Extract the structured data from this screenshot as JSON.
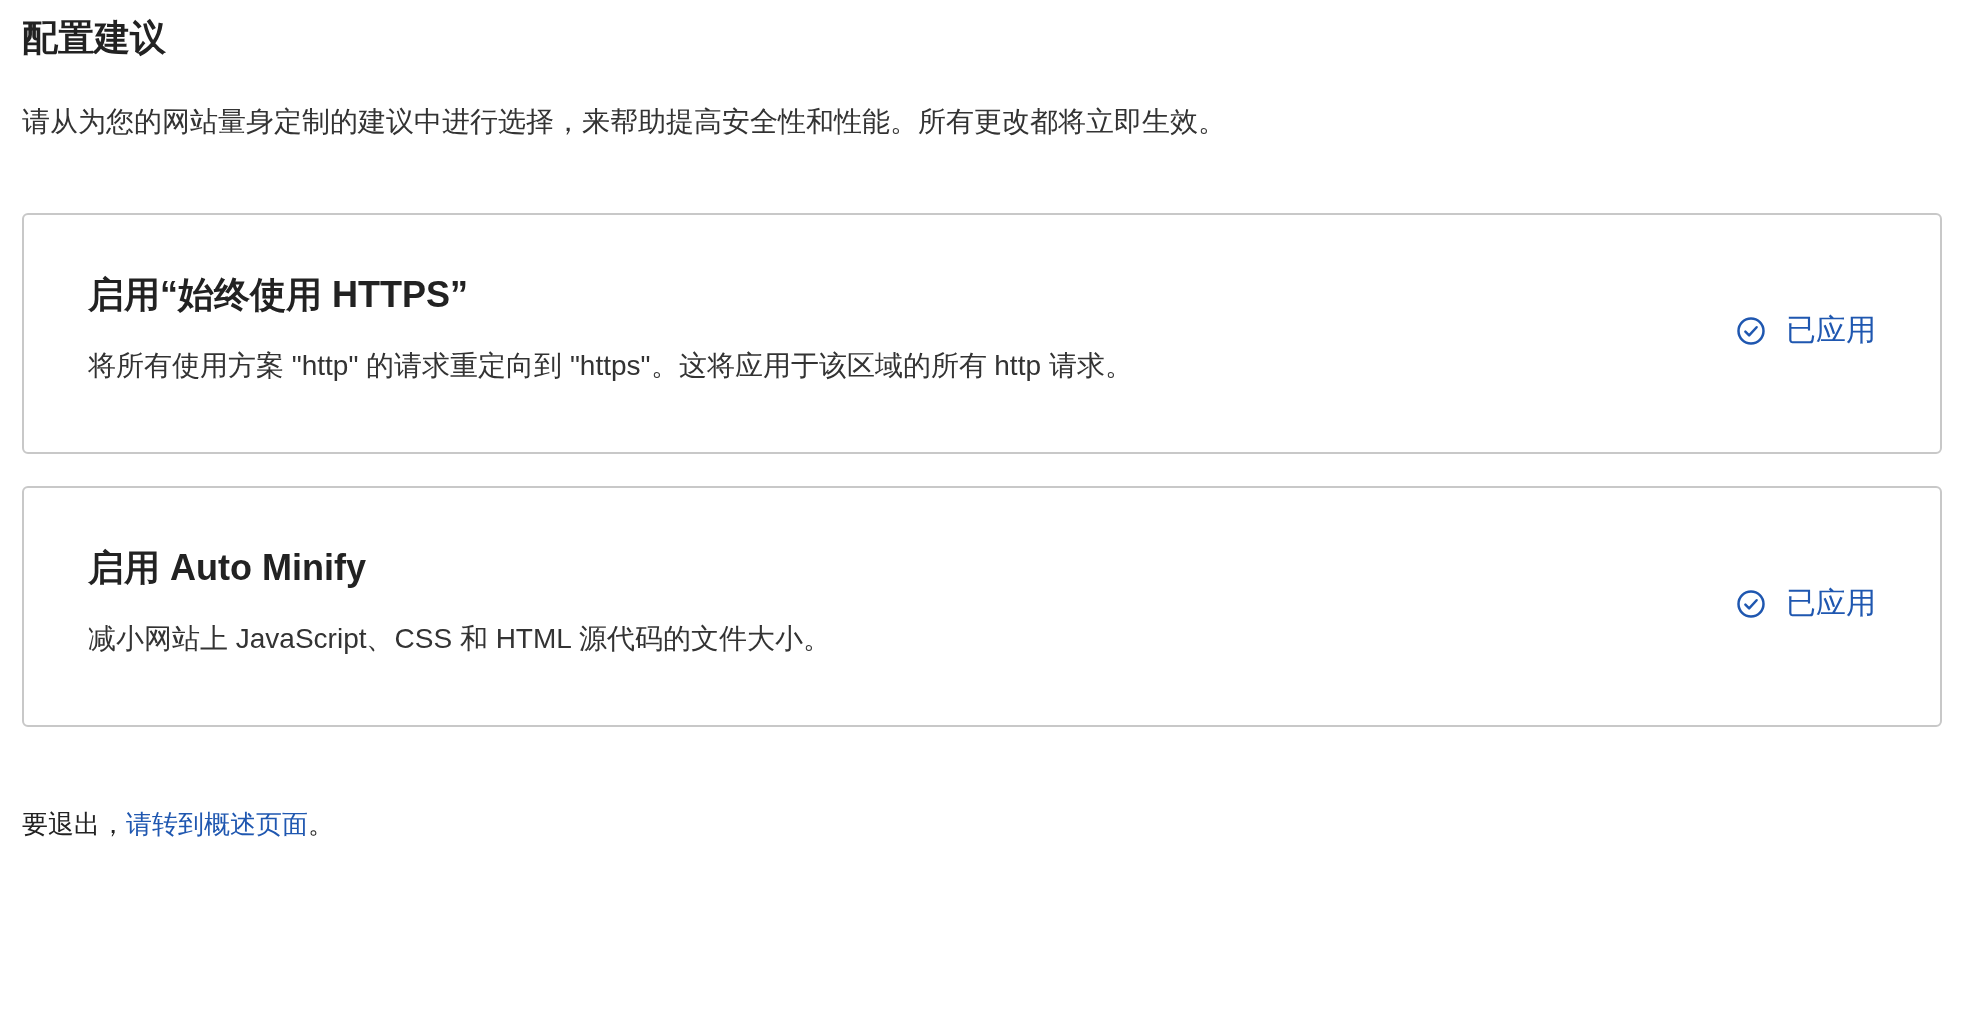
{
  "heading": "配置建议",
  "intro": "请从为您的网站量身定制的建议中进行选择，来帮助提高安全性和性能。所有更改都将立即生效。",
  "recommendations": [
    {
      "title": "启用“始终使用 HTTPS”",
      "description": "将所有使用方案 \"http\" 的请求重定向到 \"https\"。这将应用于该区域的所有 http 请求。",
      "status": {
        "label": "已应用",
        "applied": true
      }
    },
    {
      "title": "启用 Auto Minify",
      "description": "减小网站上 JavaScript、CSS 和 HTML 源代码的文件大小。",
      "status": {
        "label": "已应用",
        "applied": true
      }
    }
  ],
  "footer": {
    "text": "要退出，",
    "link": "请转到概述页面",
    "end": "。"
  }
}
